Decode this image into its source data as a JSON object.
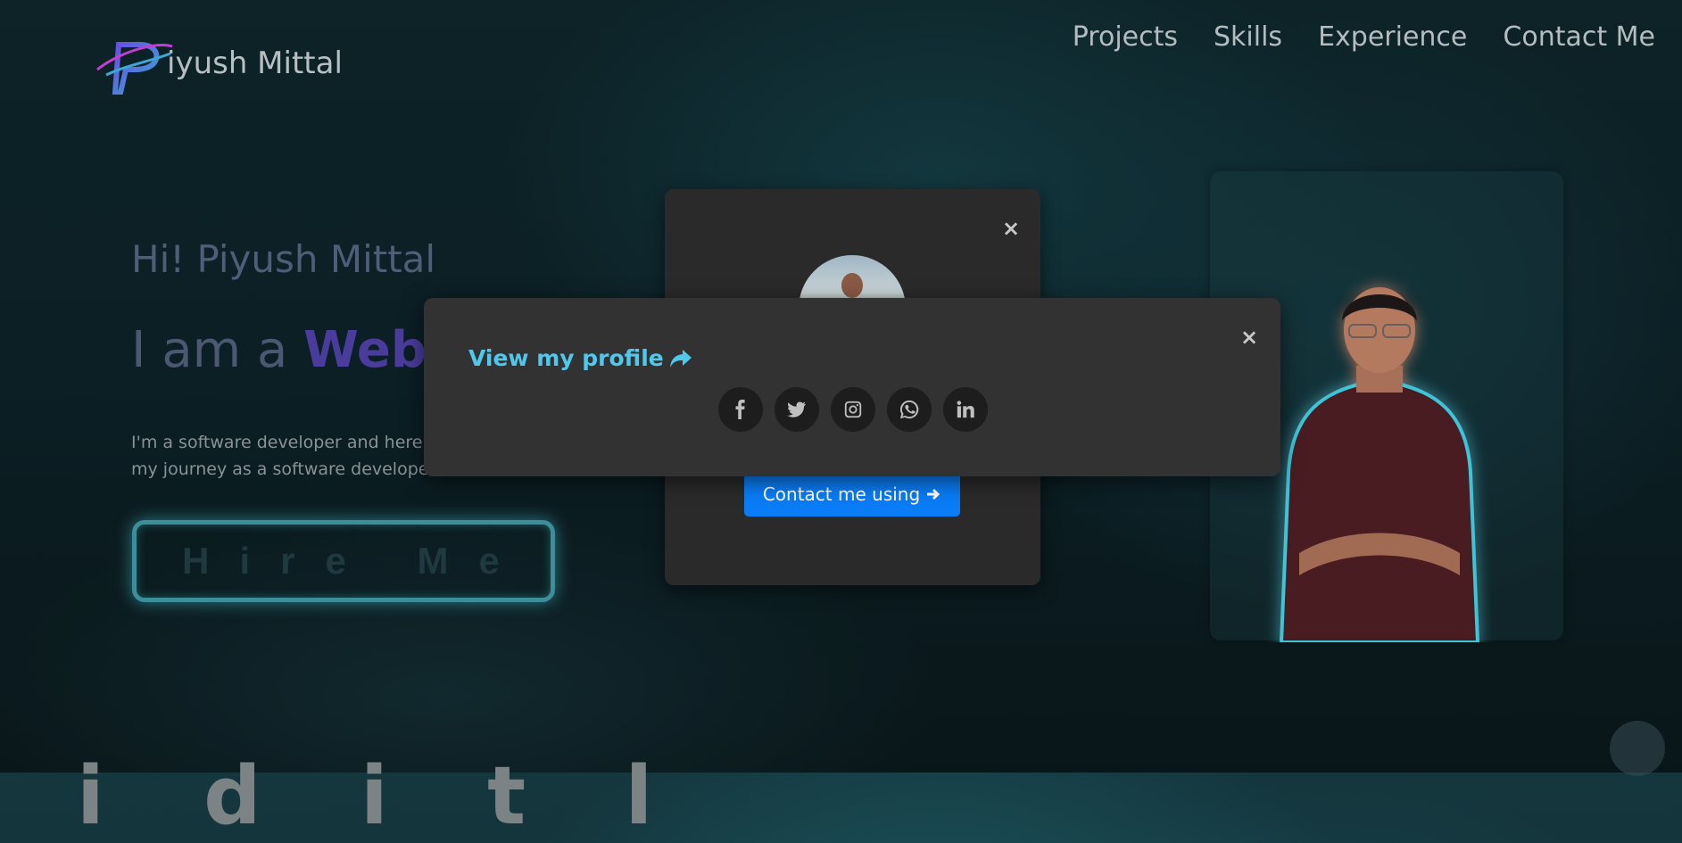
{
  "header": {
    "logo_text": "iyush Mittal",
    "nav": [
      "Projects",
      "Skills",
      "Experience",
      "Contact Me"
    ]
  },
  "hero": {
    "greeting": "Hi! Piyush Mittal",
    "iam_prefix": "I am a ",
    "role_visible": "Web D",
    "intro": "I'm a software developer and here my journey as a software develope",
    "hire_label": "Hire Me"
  },
  "bottom_heading": "i  d i t l",
  "modal_back": {
    "close": "×",
    "contact_label": "Contact me using",
    "contact_icon": "arrow-right-icon"
  },
  "modal_front": {
    "close": "×",
    "view_profile": "View my profile",
    "view_icon": "share-icon",
    "socials": [
      "facebook-icon",
      "twitter-icon",
      "instagram-icon",
      "whatsapp-icon",
      "linkedin-icon"
    ]
  },
  "colors": {
    "accent_cyan": "#52c7ec",
    "button_blue": "#0a7cf6",
    "role_purple": "#4a3c9c"
  }
}
